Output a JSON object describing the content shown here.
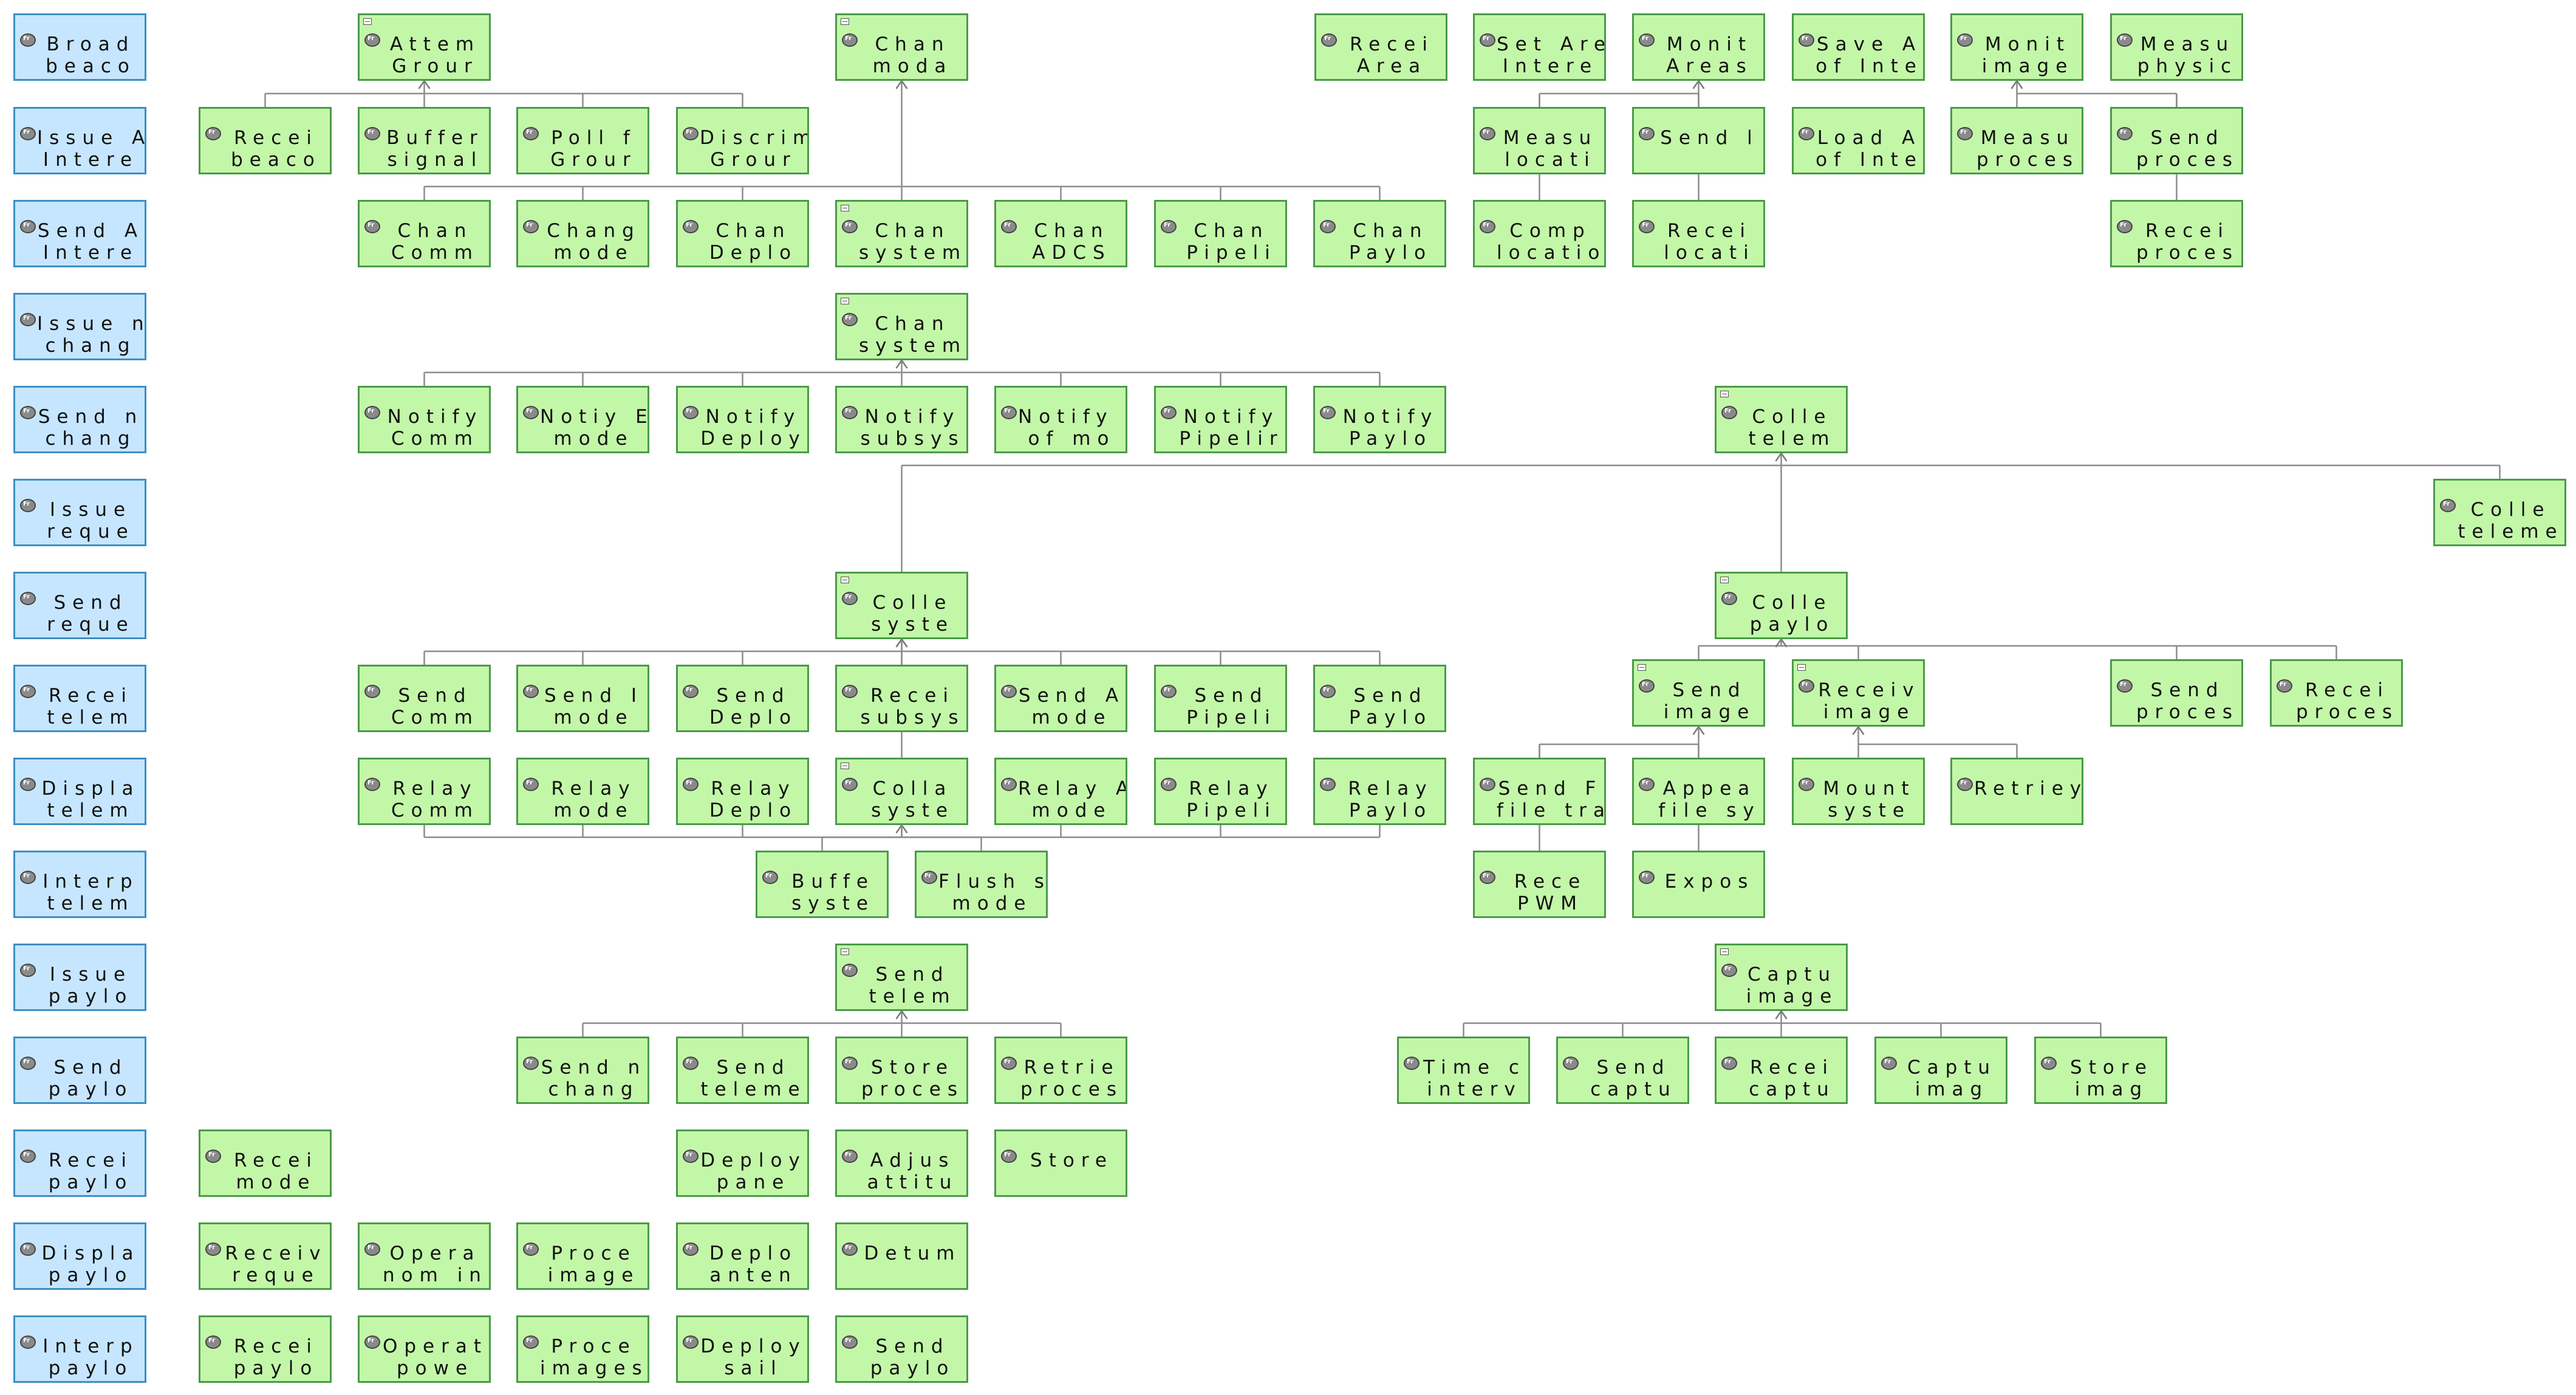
{
  "diagram": {
    "requirements": [
      {
        "id": "r1",
        "l1": "Broad",
        "l2": "beaco"
      },
      {
        "id": "r2",
        "l1": "Issue A",
        "l2": "Intere"
      },
      {
        "id": "r3",
        "l1": "Send A",
        "l2": "Intere"
      },
      {
        "id": "r4",
        "l1": "Issue n",
        "l2": "chang"
      },
      {
        "id": "r5",
        "l1": "Send n",
        "l2": "chang"
      },
      {
        "id": "r6",
        "l1": "Issue",
        "l2": "reque"
      },
      {
        "id": "r7",
        "l1": "Send",
        "l2": "reque"
      },
      {
        "id": "r8",
        "l1": "Recei",
        "l2": "telem"
      },
      {
        "id": "r9",
        "l1": "Displa",
        "l2": "telem"
      },
      {
        "id": "r10",
        "l1": "Interp",
        "l2": "telem"
      },
      {
        "id": "r11",
        "l1": "Issue",
        "l2": "paylo"
      },
      {
        "id": "r12",
        "l1": "Send",
        "l2": "paylo"
      },
      {
        "id": "r13",
        "l1": "Recei",
        "l2": "paylo"
      },
      {
        "id": "r14",
        "l1": "Displa",
        "l2": "paylo"
      },
      {
        "id": "r15",
        "l1": "Interp",
        "l2": "paylo"
      }
    ],
    "functions": [
      {
        "id": "attempt",
        "l1": "Attem",
        "l2": "Grour",
        "composite": true
      },
      {
        "id": "change_mode",
        "l1": "Chan",
        "l2": "moda",
        "composite": true
      },
      {
        "id": "recv_area",
        "l1": "Recei",
        "l2": "Area"
      },
      {
        "id": "set_area",
        "l1": "Set Are",
        "l2": "Intere"
      },
      {
        "id": "monitor_areas",
        "l1": "Monit",
        "l2": "Areas"
      },
      {
        "id": "save_area",
        "l1": "Save A",
        "l2": "of Inte"
      },
      {
        "id": "monitor_image",
        "l1": "Monit",
        "l2": "image"
      },
      {
        "id": "measure_phys",
        "l1": "Measu",
        "l2": "physic"
      },
      {
        "id": "recv_beacon",
        "l1": "Recei",
        "l2": "beaco"
      },
      {
        "id": "buffer_signal",
        "l1": "Buffer",
        "l2": "signal"
      },
      {
        "id": "poll_ground",
        "l1": "Poll f",
        "l2": "Grour"
      },
      {
        "id": "discrim",
        "l1": "Discrim",
        "l2": "Grour"
      },
      {
        "id": "measure_loc",
        "l1": "Measu",
        "l2": "locati"
      },
      {
        "id": "send_loc",
        "l1": "Send l",
        "l2": ""
      },
      {
        "id": "load_area",
        "l1": "Load A",
        "l2": "of Inte"
      },
      {
        "id": "measure_proc",
        "l1": "Measu",
        "l2": "proces"
      },
      {
        "id": "send_proc",
        "l1": "Send",
        "l2": "proces"
      },
      {
        "id": "chan_comm",
        "l1": "Chan",
        "l2": "Comm"
      },
      {
        "id": "chan_mode",
        "l1": "Chang",
        "l2": "mode"
      },
      {
        "id": "chan_deploy",
        "l1": "Chan",
        "l2": "Deplo"
      },
      {
        "id": "chan_sys",
        "l1": "Chan",
        "l2": "system",
        "composite": true
      },
      {
        "id": "chan_adcs",
        "l1": "Chan",
        "l2": "ADCS"
      },
      {
        "id": "chan_pipe",
        "l1": "Chan",
        "l2": "Pipeli"
      },
      {
        "id": "chan_payload",
        "l1": "Chan",
        "l2": "Paylo"
      },
      {
        "id": "comp_loc",
        "l1": "Comp",
        "l2": "locatio"
      },
      {
        "id": "recv_loc",
        "l1": "Recei",
        "l2": "locati"
      },
      {
        "id": "recv_proc",
        "l1": "Recei",
        "l2": "proces"
      },
      {
        "id": "chan_sys2",
        "l1": "Chan",
        "l2": "system",
        "composite": true
      },
      {
        "id": "notify_comm",
        "l1": "Notify",
        "l2": "Comm"
      },
      {
        "id": "notify_mode",
        "l1": "Notiy E",
        "l2": "mode"
      },
      {
        "id": "notify_deploy",
        "l1": "Notify",
        "l2": "Deploy"
      },
      {
        "id": "notify_subsys",
        "l1": "Notify",
        "l2": "subsys"
      },
      {
        "id": "notify_ofmo",
        "l1": "Notify A",
        "l2": "of mo"
      },
      {
        "id": "notify_pipe",
        "l1": "Notify",
        "l2": "Pipelir"
      },
      {
        "id": "notify_payload",
        "l1": "Notify",
        "l2": "Paylo"
      },
      {
        "id": "collect_telem",
        "l1": "Colle",
        "l2": "telem",
        "composite": true
      },
      {
        "id": "collect_telem_r",
        "l1": "Colle",
        "l2": "teleme"
      },
      {
        "id": "collect_sys",
        "l1": "Colle",
        "l2": "syste",
        "composite": true
      },
      {
        "id": "collect_payload",
        "l1": "Colle",
        "l2": "paylo",
        "composite": true
      },
      {
        "id": "send_comm",
        "l1": "Send",
        "l2": "Comm"
      },
      {
        "id": "send_mode",
        "l1": "Send I",
        "l2": "mode"
      },
      {
        "id": "send_deploy",
        "l1": "Send",
        "l2": "Deplo"
      },
      {
        "id": "recv_subsys",
        "l1": "Recei",
        "l2": "subsys"
      },
      {
        "id": "send_amode",
        "l1": "Send A",
        "l2": "mode"
      },
      {
        "id": "send_pipe",
        "l1": "Send",
        "l2": "Pipeli"
      },
      {
        "id": "send_payload",
        "l1": "Send",
        "l2": "Paylo"
      },
      {
        "id": "send_image",
        "l1": "Send",
        "l2": "image",
        "composite": true
      },
      {
        "id": "recv_image",
        "l1": "Receiv",
        "l2": "image",
        "composite": true
      },
      {
        "id": "send_proc2",
        "l1": "Send",
        "l2": "proces"
      },
      {
        "id": "recv_proc2",
        "l1": "Recei",
        "l2": "proces"
      },
      {
        "id": "relay_comm",
        "l1": "Relay",
        "l2": "Comm"
      },
      {
        "id": "relay_mode",
        "l1": "Relay",
        "l2": "mode"
      },
      {
        "id": "relay_deploy",
        "l1": "Relay",
        "l2": "Deplo"
      },
      {
        "id": "collate_sys",
        "l1": "Colla",
        "l2": "syste",
        "composite": true
      },
      {
        "id": "relay_amode",
        "l1": "Relay A",
        "l2": "mode"
      },
      {
        "id": "relay_pipe",
        "l1": "Relay",
        "l2": "Pipeli"
      },
      {
        "id": "relay_payload",
        "l1": "Relay",
        "l2": "Paylo"
      },
      {
        "id": "send_filetr",
        "l1": "Send F",
        "l2": "file tra"
      },
      {
        "id": "append_fs",
        "l1": "Appea",
        "l2": "file sy"
      },
      {
        "id": "mount_sys",
        "l1": "Mount",
        "l2": "syste"
      },
      {
        "id": "retrieve",
        "l1": "Retriey",
        "l2": ""
      },
      {
        "id": "buffer_sys",
        "l1": "Buffe",
        "l2": "syste"
      },
      {
        "id": "flush_mode",
        "l1": "Flush s",
        "l2": "mode"
      },
      {
        "id": "recv_pwm",
        "l1": "Rece",
        "l2": "PWM"
      },
      {
        "id": "expose",
        "l1": "Expos",
        "l2": ""
      },
      {
        "id": "send_telem",
        "l1": "Send",
        "l2": "telem",
        "composite": true
      },
      {
        "id": "capture_image",
        "l1": "Captu",
        "l2": "image",
        "composite": true
      },
      {
        "id": "send_chang",
        "l1": "Send n",
        "l2": "chang"
      },
      {
        "id": "send_teleme",
        "l1": "Send",
        "l2": "teleme"
      },
      {
        "id": "store_proc",
        "l1": "Store",
        "l2": "proces"
      },
      {
        "id": "retrieve_proc",
        "l1": "Retrie",
        "l2": "proces"
      },
      {
        "id": "time_interv",
        "l1": "Time c",
        "l2": "interv"
      },
      {
        "id": "send_capt",
        "l1": "Send",
        "l2": "captu"
      },
      {
        "id": "recv_capt",
        "l1": "Recei",
        "l2": "captu"
      },
      {
        "id": "capture_imag",
        "l1": "Captu",
        "l2": "imag"
      },
      {
        "id": "store_imag",
        "l1": "Store",
        "l2": "imag"
      },
      {
        "id": "recv_mode",
        "l1": "Recei",
        "l2": "mode"
      },
      {
        "id": "deploy_panel",
        "l1": "Deploy",
        "l2": "pane"
      },
      {
        "id": "adjust_att",
        "l1": "Adjus",
        "l2": "attitu"
      },
      {
        "id": "store",
        "l1": "Store",
        "l2": ""
      },
      {
        "id": "recv_reque",
        "l1": "Receiv",
        "l2": "reque"
      },
      {
        "id": "operate_nom",
        "l1": "Opera",
        "l2": "nom in"
      },
      {
        "id": "proc_image",
        "l1": "Proce",
        "l2": "image"
      },
      {
        "id": "deploy_ant",
        "l1": "Deplo",
        "l2": "anten"
      },
      {
        "id": "detum",
        "l1": "Detum",
        "l2": ""
      },
      {
        "id": "recv_paylo",
        "l1": "Recei",
        "l2": "paylo"
      },
      {
        "id": "operate_pow",
        "l1": "Operat",
        "l2": "powe"
      },
      {
        "id": "proc_images",
        "l1": "Proce",
        "l2": "images"
      },
      {
        "id": "deploy_sail",
        "l1": "Deploy",
        "l2": "sail"
      },
      {
        "id": "send_paylo",
        "l1": "Send",
        "l2": "paylo"
      }
    ],
    "edges": [
      [
        "attempt",
        [
          "recv_beacon",
          "buffer_signal",
          "poll_ground",
          "discrim"
        ]
      ],
      [
        "change_mode",
        [
          "chan_comm",
          "chan_mode",
          "chan_deploy",
          "chan_sys",
          "chan_adcs",
          "chan_pipe",
          "chan_payload"
        ]
      ],
      [
        "chan_sys2",
        [
          "notify_comm",
          "notify_mode",
          "notify_deploy",
          "notify_subsys",
          "notify_ofmo",
          "notify_pipe",
          "notify_payload"
        ]
      ],
      [
        "monitor_areas",
        [
          "measure_loc",
          "send_loc",
          "comp_loc",
          "recv_loc"
        ]
      ],
      [
        "monitor_image",
        [
          "measure_proc",
          "send_proc",
          "recv_proc"
        ]
      ],
      [
        "collect_telem",
        [
          "collect_sys",
          "collect_payload",
          "collect_telem_r"
        ]
      ],
      [
        "collect_sys",
        [
          "send_comm",
          "send_mode",
          "send_deploy",
          "recv_subsys",
          "send_amode",
          "send_pipe",
          "send_payload"
        ]
      ],
      [
        "collate_sys",
        [
          "relay_comm",
          "relay_mode",
          "relay_deploy",
          "relay_amode",
          "relay_pipe",
          "relay_payload"
        ]
      ],
      [
        "collect_payload",
        [
          "send_image",
          "recv_image",
          "send_proc2",
          "recv_proc2"
        ]
      ],
      [
        "send_image",
        [
          "send_filetr",
          "append_fs",
          "recv_pwm",
          "expose"
        ]
      ],
      [
        "recv_image",
        [
          "mount_sys",
          "retrieve"
        ]
      ],
      [
        "collect_sys",
        [
          "buffer_sys",
          "flush_mode"
        ]
      ],
      [
        "send_telem",
        [
          "send_chang",
          "send_teleme",
          "store_proc",
          "retrieve_proc"
        ]
      ],
      [
        "capture_image",
        [
          "time_interv",
          "send_capt",
          "recv_capt",
          "capture_imag",
          "store_imag"
        ]
      ]
    ]
  }
}
